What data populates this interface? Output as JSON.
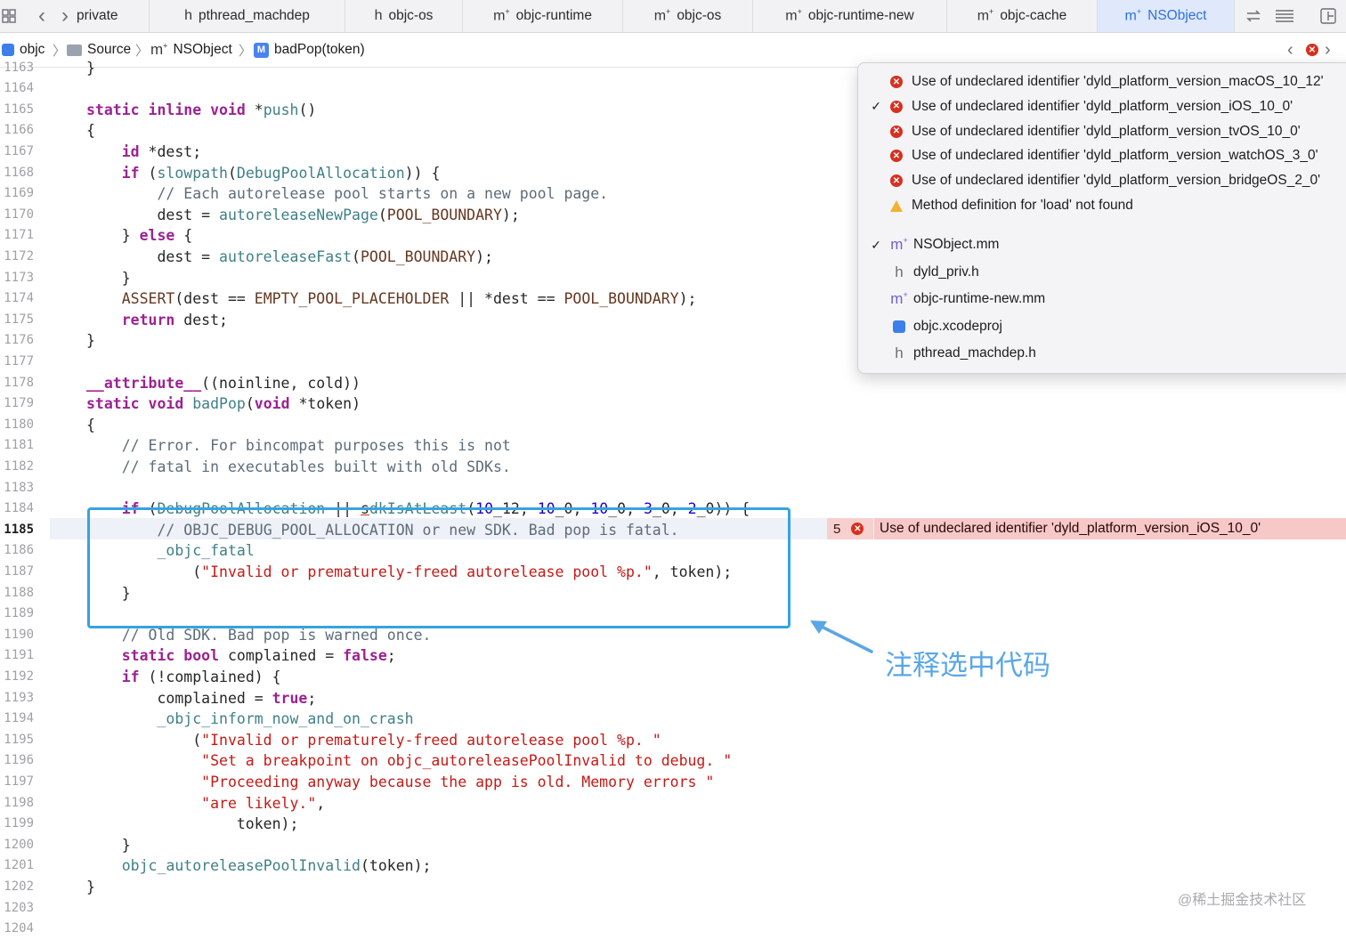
{
  "tabs": {
    "grid_icon": "grid-icon",
    "back_icon": "‹",
    "forward_icon": "›",
    "items": [
      {
        "label": "private",
        "glyph": "",
        "active": false
      },
      {
        "label": "pthread_machdep",
        "glyph": "h",
        "active": false
      },
      {
        "label": "objc-os",
        "glyph": "h",
        "active": false
      },
      {
        "label": "objc-runtime",
        "glyph": "m",
        "active": false
      },
      {
        "label": "objc-os",
        "glyph": "m",
        "active": false
      },
      {
        "label": "objc-runtime-new",
        "glyph": "m",
        "active": false
      },
      {
        "label": "objc-cache",
        "glyph": "m",
        "active": false
      },
      {
        "label": "NSObject",
        "glyph": "m",
        "active": true
      }
    ],
    "active_color": "#2f6fe6"
  },
  "breadcrumb": {
    "project": "objc",
    "folder": "Source",
    "file": "NSObject",
    "symbol": "badPop(token)",
    "symbol_badge": "M"
  },
  "gutter": {
    "lines": [
      "1163",
      "1164",
      "1165",
      "1166",
      "1167",
      "1168",
      "1169",
      "1170",
      "1171",
      "1172",
      "1173",
      "1174",
      "1175",
      "1176",
      "1177",
      "1178",
      "1179",
      "1180",
      "1181",
      "1182",
      "1183",
      "1184",
      "1185",
      "1186",
      "1187",
      "1188",
      "1189",
      "1190",
      "1191",
      "1192",
      "1193",
      "1194",
      "1195",
      "1196",
      "1197",
      "1198",
      "1199",
      "1200",
      "1201",
      "1202",
      "1203",
      "1204"
    ],
    "current_line": "1185"
  },
  "code": [
    {
      "tokens": [
        [
          "p",
          "}"
        ]
      ]
    },
    {
      "tokens": []
    },
    {
      "tokens": [
        [
          "kw",
          "static"
        ],
        [
          "p",
          " "
        ],
        [
          "kw",
          "inline"
        ],
        [
          "p",
          " "
        ],
        [
          "kw",
          "void"
        ],
        [
          "p",
          " *"
        ],
        [
          "fn",
          "push"
        ],
        [
          "p",
          "()"
        ]
      ]
    },
    {
      "tokens": [
        [
          "p",
          "{"
        ]
      ]
    },
    {
      "tokens": [
        [
          "p",
          "    "
        ],
        [
          "kw",
          "id"
        ],
        [
          "p",
          " *dest;"
        ]
      ]
    },
    {
      "tokens": [
        [
          "p",
          "    "
        ],
        [
          "kw",
          "if"
        ],
        [
          "p",
          " ("
        ],
        [
          "fn",
          "slowpath"
        ],
        [
          "p",
          "("
        ],
        [
          "pl",
          "DebugPoolAllocation"
        ],
        [
          "p",
          ")) {"
        ]
      ]
    },
    {
      "tokens": [
        [
          "p",
          "        "
        ],
        [
          "cm",
          "// Each autorelease pool starts on a new pool page."
        ]
      ]
    },
    {
      "tokens": [
        [
          "p",
          "        dest = "
        ],
        [
          "fn",
          "autoreleaseNewPage"
        ],
        [
          "p",
          "("
        ],
        [
          "mc",
          "POOL_BOUNDARY"
        ],
        [
          "p",
          ");"
        ]
      ]
    },
    {
      "tokens": [
        [
          "p",
          "    } "
        ],
        [
          "kw",
          "else"
        ],
        [
          "p",
          " {"
        ]
      ]
    },
    {
      "tokens": [
        [
          "p",
          "        dest = "
        ],
        [
          "fn",
          "autoreleaseFast"
        ],
        [
          "p",
          "("
        ],
        [
          "mc",
          "POOL_BOUNDARY"
        ],
        [
          "p",
          ");"
        ]
      ]
    },
    {
      "tokens": [
        [
          "p",
          "    }"
        ]
      ]
    },
    {
      "tokens": [
        [
          "p",
          "    "
        ],
        [
          "mc",
          "ASSERT"
        ],
        [
          "p",
          "(dest == "
        ],
        [
          "mc",
          "EMPTY_POOL_PLACEHOLDER"
        ],
        [
          "p",
          " || *dest == "
        ],
        [
          "mc",
          "POOL_BOUNDARY"
        ],
        [
          "p",
          ");"
        ]
      ]
    },
    {
      "tokens": [
        [
          "p",
          "    "
        ],
        [
          "kw",
          "return"
        ],
        [
          "p",
          " dest;"
        ]
      ]
    },
    {
      "tokens": [
        [
          "p",
          "}"
        ]
      ]
    },
    {
      "tokens": []
    },
    {
      "tokens": [
        [
          "kw",
          "__attribute__"
        ],
        [
          "p",
          "((noinline, cold))"
        ]
      ]
    },
    {
      "tokens": [
        [
          "kw",
          "static"
        ],
        [
          "p",
          " "
        ],
        [
          "kw",
          "void"
        ],
        [
          "p",
          " "
        ],
        [
          "fn",
          "badPop"
        ],
        [
          "p",
          "("
        ],
        [
          "kw",
          "void"
        ],
        [
          "p",
          " *token)"
        ]
      ]
    },
    {
      "tokens": [
        [
          "p",
          "{"
        ]
      ]
    },
    {
      "tokens": [
        [
          "p",
          "    "
        ],
        [
          "cm",
          "// Error. For bincompat purposes this is not"
        ]
      ]
    },
    {
      "tokens": [
        [
          "p",
          "    "
        ],
        [
          "cm",
          "// fatal in executables built with old SDKs."
        ]
      ]
    },
    {
      "tokens": []
    },
    {
      "tokens": [
        [
          "p",
          "    "
        ],
        [
          "kw",
          "if"
        ],
        [
          "p",
          " ("
        ],
        [
          "pl",
          "DebugPoolAllocation"
        ],
        [
          "p",
          " || "
        ],
        [
          "ul",
          "s"
        ],
        [
          "fn",
          "dkIsAtLeast"
        ],
        [
          "p",
          "("
        ],
        [
          "nu",
          "10"
        ],
        [
          "p",
          "_12, "
        ],
        [
          "nu",
          "10"
        ],
        [
          "p",
          "_0, "
        ],
        [
          "nu",
          "10"
        ],
        [
          "p",
          "_0, "
        ],
        [
          "nu",
          "3"
        ],
        [
          "p",
          "_0, "
        ],
        [
          "nu",
          "2"
        ],
        [
          "p",
          "_0)) {"
        ]
      ]
    },
    {
      "tokens": [
        [
          "p",
          "        "
        ],
        [
          "cm",
          "// OBJC_DEBUG_POOL_ALLOCATION or new SDK. Bad pop is fatal."
        ]
      ]
    },
    {
      "tokens": [
        [
          "p",
          "        "
        ],
        [
          "fn",
          "_objc_fatal"
        ]
      ]
    },
    {
      "tokens": [
        [
          "p",
          "            ("
        ],
        [
          "st",
          "\"Invalid or prematurely-freed autorelease pool %p.\""
        ],
        [
          "p",
          ", token);"
        ]
      ]
    },
    {
      "tokens": [
        [
          "p",
          "    }"
        ]
      ]
    },
    {
      "tokens": []
    },
    {
      "tokens": [
        [
          "p",
          "    "
        ],
        [
          "cm",
          "// Old SDK. Bad pop is warned once."
        ]
      ]
    },
    {
      "tokens": [
        [
          "p",
          "    "
        ],
        [
          "kw",
          "static"
        ],
        [
          "p",
          " "
        ],
        [
          "kw",
          "bool"
        ],
        [
          "p",
          " complained = "
        ],
        [
          "kw",
          "false"
        ],
        [
          "p",
          ";"
        ]
      ]
    },
    {
      "tokens": [
        [
          "p",
          "    "
        ],
        [
          "kw",
          "if"
        ],
        [
          "p",
          " (!complained) {"
        ]
      ]
    },
    {
      "tokens": [
        [
          "p",
          "        complained = "
        ],
        [
          "kw",
          "true"
        ],
        [
          "p",
          ";"
        ]
      ]
    },
    {
      "tokens": [
        [
          "p",
          "        "
        ],
        [
          "fn",
          "_objc_inform_now_and_on_crash"
        ]
      ]
    },
    {
      "tokens": [
        [
          "p",
          "            ("
        ],
        [
          "st",
          "\"Invalid or prematurely-freed autorelease pool %p. \""
        ]
      ]
    },
    {
      "tokens": [
        [
          "p",
          "             "
        ],
        [
          "st",
          "\"Set a breakpoint on objc_autoreleasePoolInvalid to debug. \""
        ]
      ]
    },
    {
      "tokens": [
        [
          "p",
          "             "
        ],
        [
          "st",
          "\"Proceeding anyway because the app is old. Memory errors \""
        ]
      ]
    },
    {
      "tokens": [
        [
          "p",
          "             "
        ],
        [
          "st",
          "\"are likely.\""
        ],
        [
          "p",
          ","
        ]
      ]
    },
    {
      "tokens": [
        [
          "p",
          "                 token);"
        ]
      ]
    },
    {
      "tokens": [
        [
          "p",
          "    }"
        ]
      ]
    },
    {
      "tokens": [
        [
          "p",
          "    "
        ],
        [
          "fn",
          "objc_autoreleasePoolInvalid"
        ],
        [
          "p",
          "(token);"
        ]
      ]
    },
    {
      "tokens": [
        [
          "p",
          "}"
        ]
      ]
    },
    {
      "tokens": []
    }
  ],
  "inline_error": {
    "count": "5",
    "message": "Use of undeclared identifier 'dyld_platform_version_iOS_10_0'"
  },
  "popup": {
    "issues": [
      {
        "checked": false,
        "kind": "error",
        "text": "Use of undeclared identifier 'dyld_platform_version_macOS_10_12'"
      },
      {
        "checked": true,
        "kind": "error",
        "text": "Use of undeclared identifier 'dyld_platform_version_iOS_10_0'"
      },
      {
        "checked": false,
        "kind": "error",
        "text": "Use of undeclared identifier 'dyld_platform_version_tvOS_10_0'"
      },
      {
        "checked": false,
        "kind": "error",
        "text": "Use of undeclared identifier 'dyld_platform_version_watchOS_3_0'"
      },
      {
        "checked": false,
        "kind": "error",
        "text": "Use of undeclared identifier 'dyld_platform_version_bridgeOS_2_0'"
      },
      {
        "checked": false,
        "kind": "warning",
        "text": "Method definition for 'load' not found"
      }
    ],
    "files": [
      {
        "checked": true,
        "kind": "m",
        "name": "NSObject.mm"
      },
      {
        "checked": false,
        "kind": "h",
        "name": "dyld_priv.h"
      },
      {
        "checked": false,
        "kind": "m",
        "name": "objc-runtime-new.mm"
      },
      {
        "checked": false,
        "kind": "proj",
        "name": "objc.xcodeproj"
      },
      {
        "checked": false,
        "kind": "h",
        "name": "pthread_machdep.h"
      }
    ]
  },
  "annotation": {
    "text": "注释选中代码",
    "color": "#5aa6e6"
  },
  "watermark": "@稀土掘金技术社区",
  "colors": {
    "selection_border": "#37a3df",
    "error_bar": "#f6c8c8",
    "error_icon": "#d8301f",
    "keyword": "#9b2393",
    "string": "#c41a16",
    "comment": "#5d6c79"
  }
}
